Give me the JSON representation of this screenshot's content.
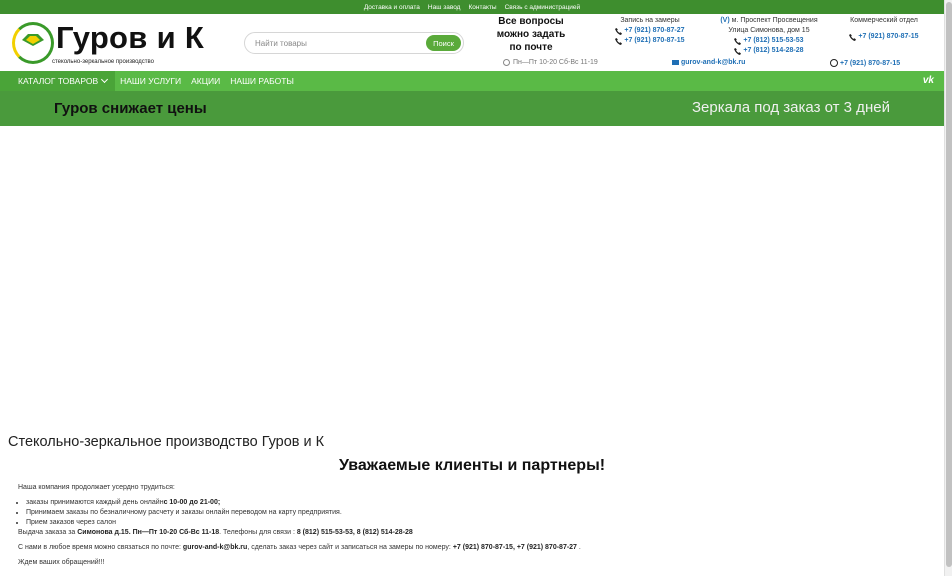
{
  "topbar": {
    "links": [
      "Доставка и оплата",
      "Наш завод",
      "Контакты",
      "Связь с администрацией"
    ]
  },
  "logo": {
    "title": "Гуров и К",
    "subtitle": "стекольно-зеркальное производство",
    "colors": {
      "green": "#3a9a2a",
      "yellow": "#f2d000"
    }
  },
  "search": {
    "placeholder": "Найти товары",
    "button": "Поиск"
  },
  "questions": {
    "line1": "Все вопросы",
    "line2": "можно задать",
    "line3": "по почте"
  },
  "hours": "Пн—Пт 10-20 Сб-Вс 11-19",
  "zamery": {
    "label": "Запись на замеры",
    "phone1": "+7 (921) 870-87-27",
    "phone2": "+7 (921) 870-87-15"
  },
  "metro": {
    "symbol": "(V)",
    "station": "м. Проспект Просвещения",
    "address": "Улица Симонова, дом 15",
    "phone1": "+7 (812) 515-53-53",
    "phone2": "+7 (812) 514-28-28"
  },
  "commercial": {
    "label": "Коммерческий отдел",
    "phone": "+7 (921) 870-87-15"
  },
  "email": "gurov-and-k@bk.ru",
  "whatsapp": "+7 (921) 870-87-15",
  "nav": {
    "items": [
      "КАТАЛОГ ТОВАРОВ",
      "НАШИ УСЛУГИ",
      "АКЦИИ",
      "НАШИ РАБОТЫ"
    ],
    "social": "vk"
  },
  "banner": {
    "left": "Гуров снижает цены",
    "right": "Зеркала под заказ от 3 дней"
  },
  "page_title": "Стекольно-зеркальное производство Гуров и К",
  "greeting": "Уважаемые клиенты и партнеры!",
  "content": {
    "intro": "Наша компания продолжает усердно трудиться:",
    "list": [
      {
        "text": "заказы принимаются каждый день онлайн",
        "bold": "с 10-00 до 21-00;"
      },
      {
        "text": "Принимаем заказы по безналичному расчету и заказы онлайн переводом на карту предприятия.",
        "bold": ""
      },
      {
        "text": "Прием заказов через салон",
        "bold": ""
      }
    ],
    "pickup_prefix": "Выдача заказа за ",
    "pickup_bold": "Симонова д.15. Пн—Пт 10-20 Сб-Вс 11-18",
    "pickup_mid": ". Телефоны для связи :  ",
    "pickup_phones": "8 (812) 515-53-53, 8 (812) 514-28-28",
    "contact_prefix": "С нами в любое время можно связаться по почте: ",
    "contact_email": "gurov-and-k@bk.ru",
    "contact_mid": ", сделать заказ через сайт и записаться на замеры по номеру: ",
    "contact_phones": "+7 (921) 870-87-15, +7 (921) 870-87-27",
    "contact_end": " .",
    "closing": "Ждем ваших обращений!!!"
  }
}
